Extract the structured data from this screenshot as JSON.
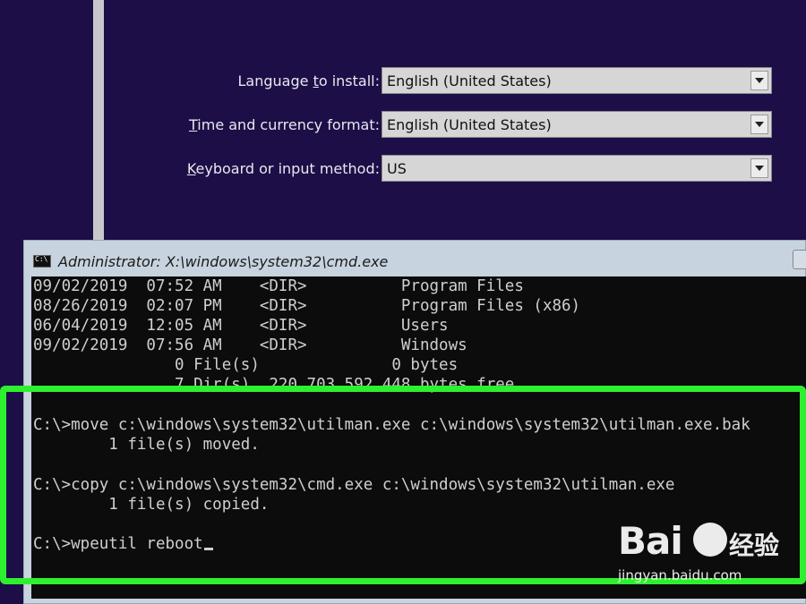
{
  "setup": {
    "language": {
      "label_pre": "Language ",
      "label_ul": "t",
      "label_post": "o install:",
      "value": "English (United States)"
    },
    "time_format": {
      "label_pre": "",
      "label_ul": "T",
      "label_post": "ime and currency format:",
      "value": "English (United States)"
    },
    "keyboard": {
      "label_pre": "",
      "label_ul": "K",
      "label_post": "eyboard or input method:",
      "value": "US"
    }
  },
  "cmd": {
    "title": "Administrator: X:\\windows\\system32\\cmd.exe",
    "lines": [
      "09/02/2019  07:52 AM    <DIR>          Program Files",
      "08/26/2019  02:07 PM    <DIR>          Program Files (x86)",
      "06/04/2019  12:05 AM    <DIR>          Users",
      "09/02/2019  07:56 AM    <DIR>          Windows",
      "               0 File(s)              0 bytes",
      "               7 Dir(s)  220,703,592,448 bytes free",
      "",
      "C:\\>move c:\\windows\\system32\\utilman.exe c:\\windows\\system32\\utilman.exe.bak",
      "        1 file(s) moved.",
      "",
      "C:\\>copy c:\\windows\\system32\\cmd.exe c:\\windows\\system32\\utilman.exe",
      "        1 file(s) copied.",
      "",
      "C:\\>wpeutil reboot"
    ]
  },
  "watermark": {
    "logo_text": "Bai",
    "logo_cn": "经验",
    "url": "jingyan.baidu.com"
  },
  "colors": {
    "background": "#1d0e47",
    "highlight": "#2ef02e",
    "console_bg": "#0c0c0c",
    "console_fg": "#cfcfcf"
  },
  "icons": [
    "cmd-app-icon",
    "dropdown-arrow-icon",
    "baidu-paw-icon"
  ]
}
